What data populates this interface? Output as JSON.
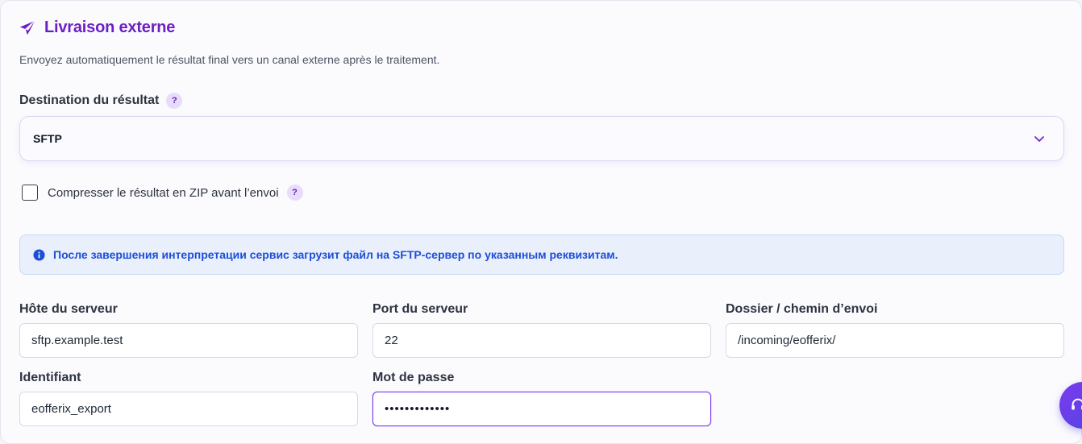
{
  "section": {
    "title": "Livraison externe",
    "title_icon": "paper-plane-icon",
    "subtitle": "Envoyez automatiquement le résultat final vers un canal externe après le traitement."
  },
  "destination": {
    "label": "Destination du résultat",
    "help": "?",
    "selected": "SFTP",
    "chevron_icon": "chevron-down-icon"
  },
  "compress": {
    "label": "Compresser le résultat en ZIP avant l’envoi",
    "checked": false,
    "help": "?"
  },
  "info": {
    "icon": "info-icon",
    "text": "После завершения интерпретации сервис загрузит файл на SFTP-сервер по указанным реквизитам."
  },
  "fields": {
    "host": {
      "label": "Hôte du serveur",
      "value": "sftp.example.test"
    },
    "port": {
      "label": "Port du serveur",
      "value": "22"
    },
    "path": {
      "label": "Dossier / chemin d’envoi",
      "value": "/incoming/eofferix/"
    },
    "user": {
      "label": "Identifiant",
      "value": "eofferix_export"
    },
    "password": {
      "label": "Mot de passe",
      "value": "•••••••••••••"
    }
  },
  "support": {
    "icon": "headset-icon"
  },
  "colors": {
    "accent": "#6d1fc4",
    "info_text": "#1d4ed8",
    "info_bg": "#e9f0fc",
    "help_badge_bg": "#e8dcfa"
  }
}
